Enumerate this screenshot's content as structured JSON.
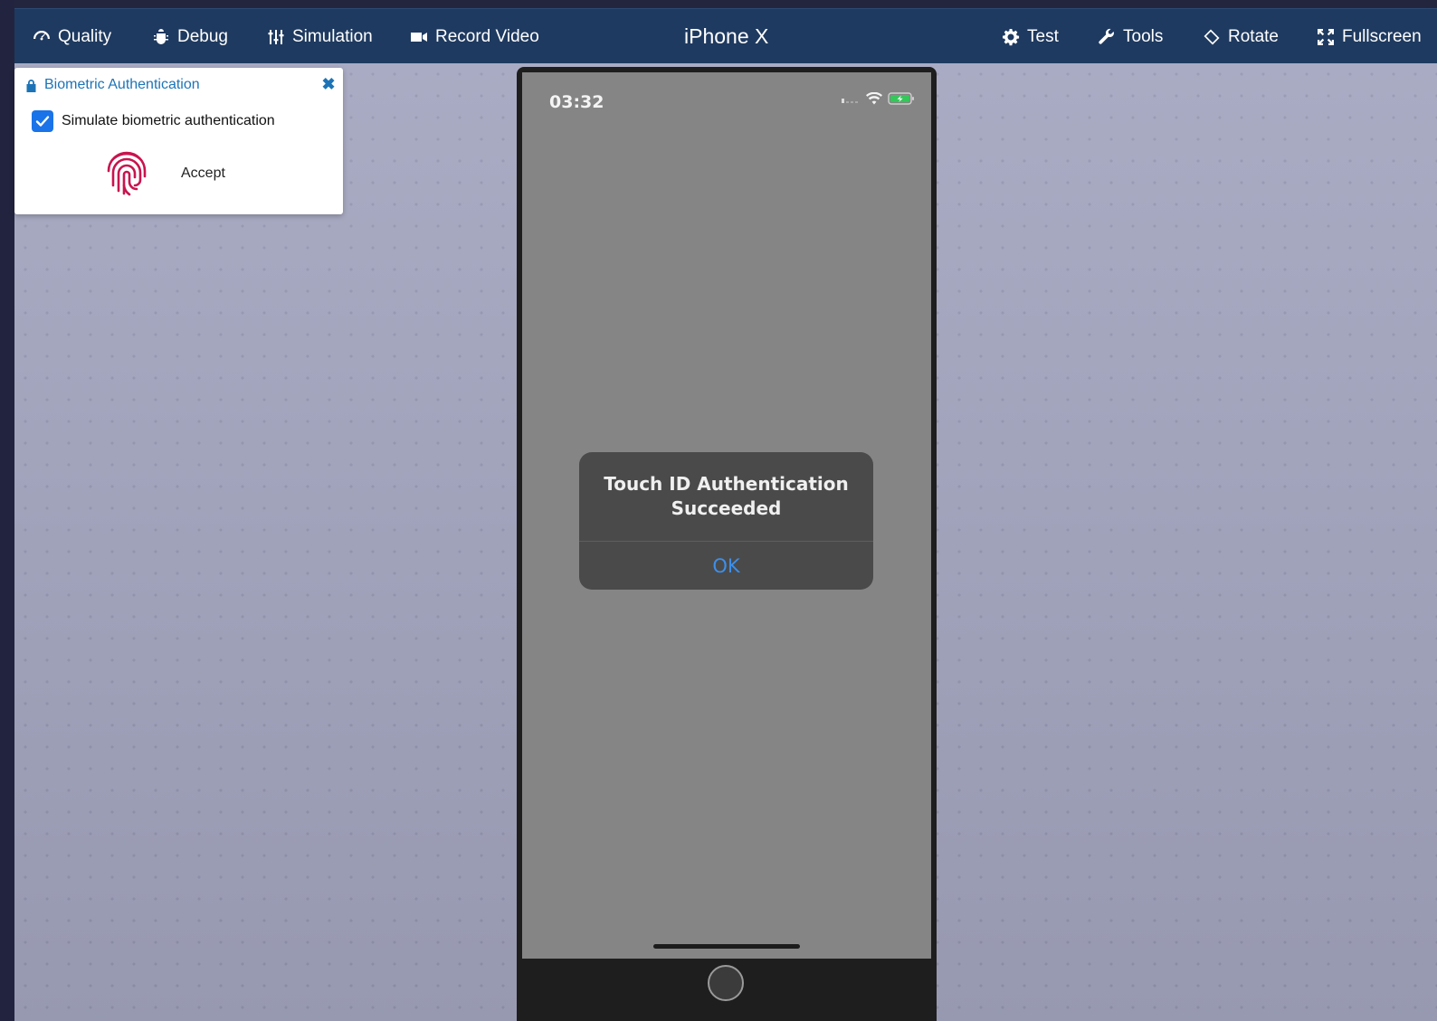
{
  "toolbar": {
    "quality_label": "Quality",
    "debug_label": "Debug",
    "simulation_label": "Simulation",
    "record_label": "Record Video",
    "device_title": "iPhone X",
    "test_label": "Test",
    "tools_label": "Tools",
    "rotate_label": "Rotate",
    "fullscreen_label": "Fullscreen"
  },
  "biometric_panel": {
    "title": "Biometric Authentication",
    "checkbox_label": "Simulate biometric authentication",
    "checkbox_checked": true,
    "accept_label": "Accept"
  },
  "phone": {
    "status_time": "03:32",
    "alert": {
      "title_line1": "Touch ID Authentication",
      "title_line2": "Succeeded",
      "ok_label": "OK"
    }
  },
  "colors": {
    "toolbar_bg": "#1f3a60",
    "panel_accent": "#1c74b7",
    "fingerprint": "#c8144f",
    "alert_button": "#3d8fe9"
  }
}
